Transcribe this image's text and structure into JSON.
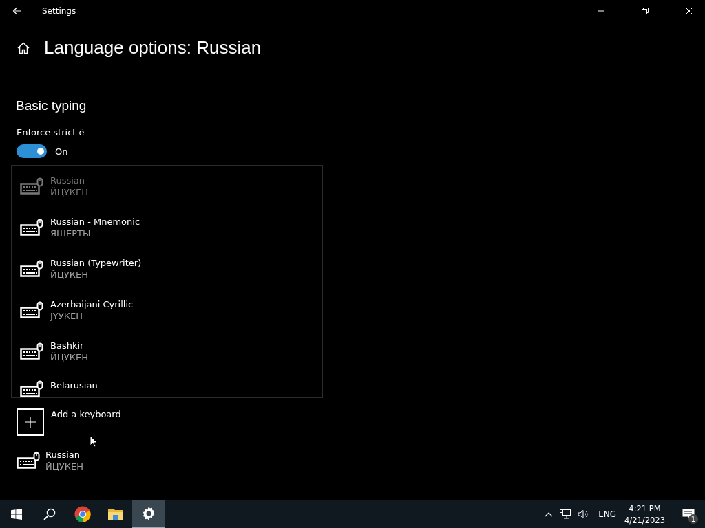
{
  "window": {
    "title": "Settings"
  },
  "page": {
    "title": "Language options: Russian"
  },
  "section": {
    "title": "Basic typing"
  },
  "toggle": {
    "label": "Enforce strict ё",
    "on": true,
    "state_text": "On"
  },
  "keyboard_list": [
    {
      "name": "Russian",
      "layout": "ЙЦУКЕН",
      "disabled": true
    },
    {
      "name": "Russian - Mnemonic",
      "layout": "ЯШЕРТЫ",
      "disabled": false
    },
    {
      "name": "Russian (Typewriter)",
      "layout": "ЙЦУКЕН",
      "disabled": false
    },
    {
      "name": "Azerbaijani Cyrillic",
      "layout": "ЈҮУКЕН",
      "disabled": false
    },
    {
      "name": "Bashkir",
      "layout": "ЙЦУКЕН",
      "disabled": false
    },
    {
      "name": "Belarusian",
      "disabled": false
    }
  ],
  "add_keyboard": {
    "label": "Add a keyboard"
  },
  "installed_keyboards": [
    {
      "name": "Russian",
      "layout": "ЙЦУКЕН"
    }
  ],
  "taskbar": {
    "apps": [
      {
        "kind": "start",
        "selected": false
      },
      {
        "kind": "search",
        "selected": false
      },
      {
        "kind": "chrome",
        "selected": false
      },
      {
        "kind": "files",
        "selected": false
      },
      {
        "kind": "settings",
        "selected": true
      }
    ],
    "language": "ENG",
    "time": "4:21 PM",
    "date": "4/21/2023",
    "notification_count": "1"
  }
}
